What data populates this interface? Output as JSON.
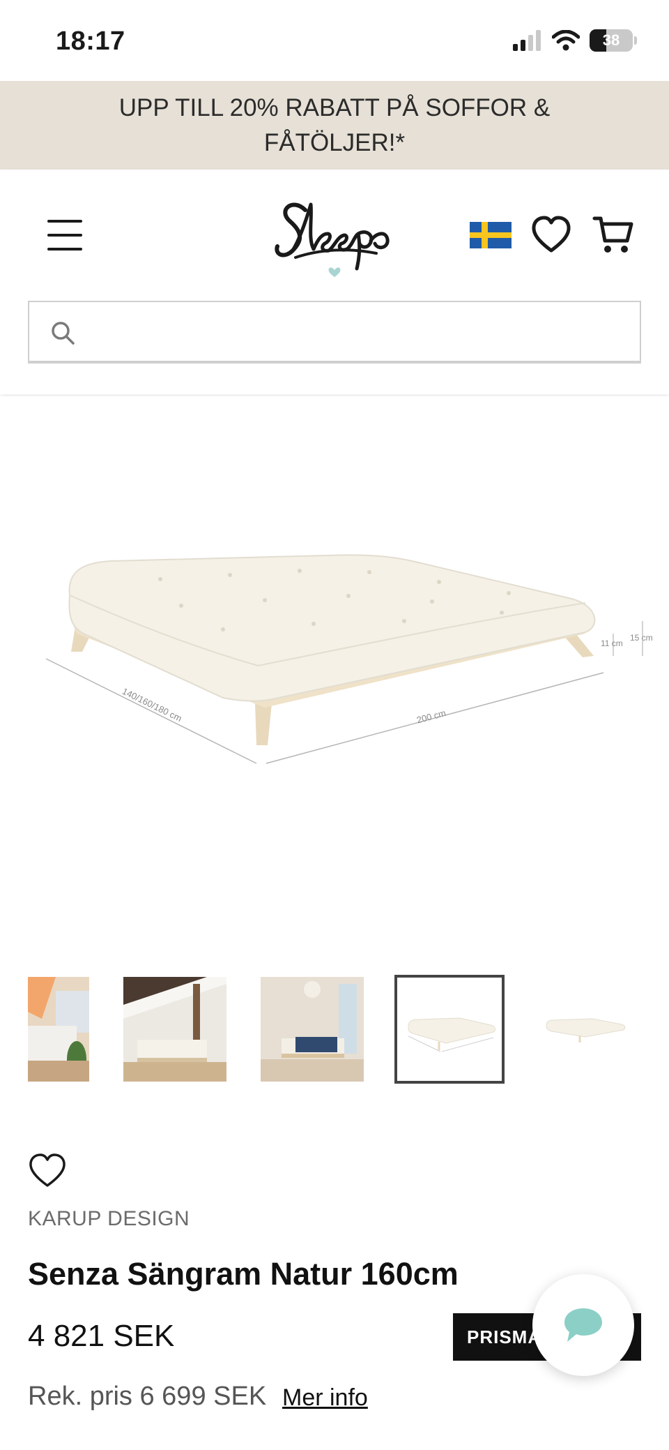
{
  "status_bar": {
    "time": "18:17",
    "battery_level": "38",
    "battery_fraction": 0.38
  },
  "promo": {
    "text": "UPP TILL 20% RABATT PÅ SOFFOR & FÅTÖLJER!*"
  },
  "header": {
    "logo_text": "Sleepo",
    "country_flag": "sweden-flag",
    "icons": [
      "menu-icon",
      "heart-icon",
      "cart-icon"
    ],
    "search": {
      "value": "",
      "placeholder": ""
    }
  },
  "gallery": {
    "thumbnails": [
      "room-bed-photo",
      "attic-bed-photo",
      "bedroom-blue-blanket-photo",
      "bed-dimensions-photo",
      "bed-side-photo"
    ],
    "selected_index": 3,
    "dimension_labels": {
      "width": "140/160/180 cm",
      "length": "200 cm",
      "frame_height": "11 cm",
      "mattress_height": "15 cm"
    }
  },
  "product": {
    "brand": "KARUP DESIGN",
    "title": "Senza Sängram Natur 160cm",
    "price": "4 821 SEK",
    "prisma_button": "PRISMATCH",
    "recommended_price": "Rek. pris 6 699 SEK",
    "more_info": "Mer info"
  },
  "colors": {
    "promo_bg": "#e6e0d6",
    "accent_mint": "#a8d5d1",
    "button_dark": "#111111",
    "flag_blue": "#1f5ba8",
    "flag_yellow": "#f7c51e"
  }
}
